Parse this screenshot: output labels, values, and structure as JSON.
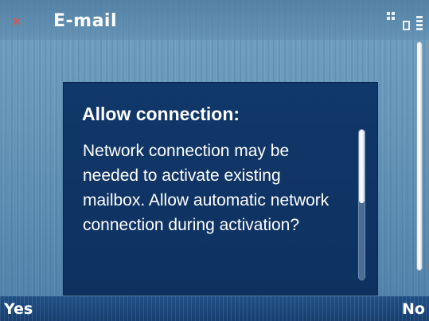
{
  "titlebar": {
    "title": "E-mail",
    "close_glyph": "×",
    "close_icon": "close-icon",
    "status_icons": [
      "app-grid-icon",
      "lock-icon",
      "battery-icon"
    ]
  },
  "dialog": {
    "title": "Allow connection:",
    "message": "Network connection may be needed to activate existing mailbox. Allow automatic network connection during activation?"
  },
  "softkeys": {
    "left_label": "Yes",
    "right_label": "No"
  },
  "colors": {
    "accent_close": "#e0524f",
    "dialog_background": "#0f3460",
    "softkey_background": "#1f4f86",
    "text": "#ffffff"
  }
}
